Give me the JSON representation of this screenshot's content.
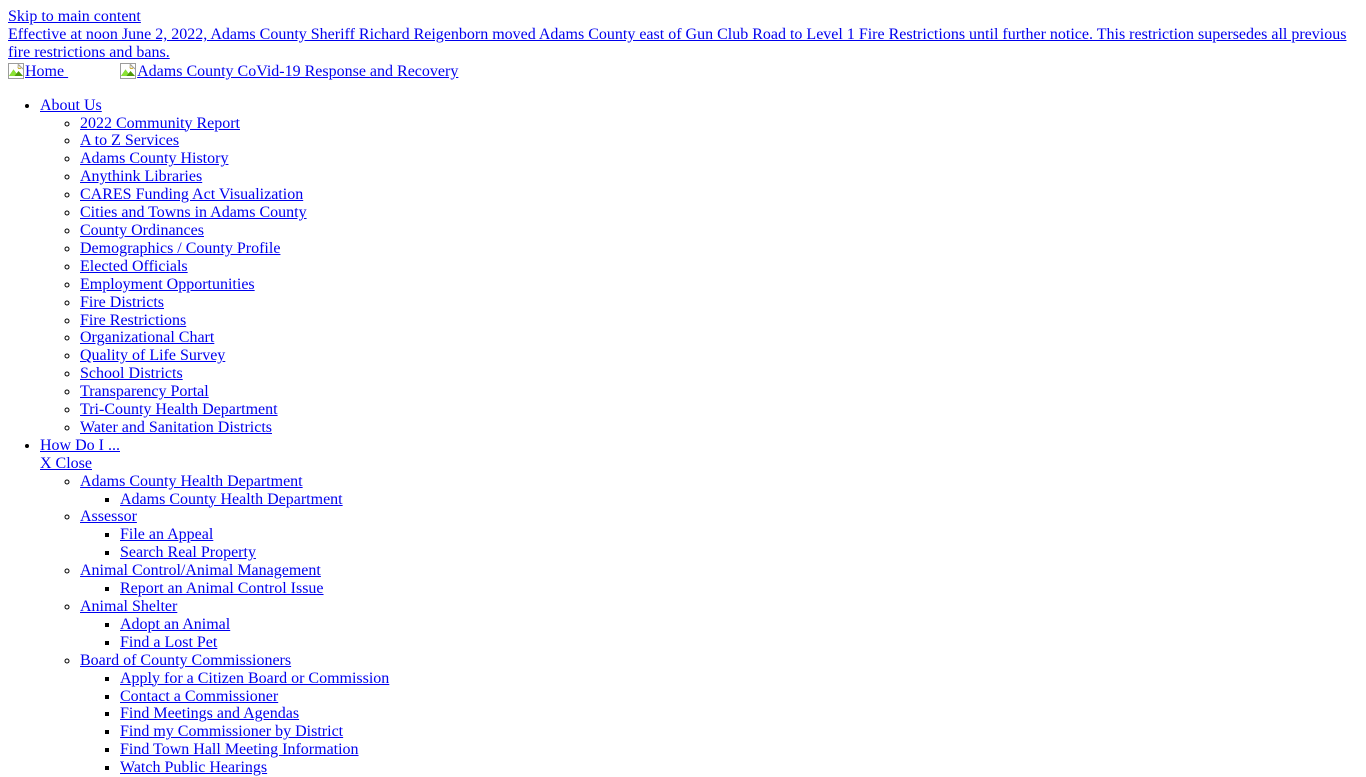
{
  "page": {
    "background": "#ffffff",
    "link_color": "#0000EE",
    "text_color": "#000000"
  },
  "skip_link": {
    "label": "Skip to main content"
  },
  "alert": {
    "text": "Effective at noon June 2, 2022, Adams County Sheriff Richard Reigenborn moved Adams County east of Gun Club Road to Level 1 Fire Restrictions until further notice. This restriction supersedes all previous fire restrictions and bans."
  },
  "header": {
    "home_link": {
      "label": "Home ",
      "icon": "broken-image-icon",
      "alt": "Home"
    },
    "covid_link": {
      "label": "Adams County CoVid-19 Response and Recovery",
      "icon": "broken-image-icon",
      "alt": "Adams County CoVid-19 Response and Recovery"
    }
  },
  "nav": {
    "items": [
      {
        "label": "About Us",
        "children": [
          {
            "label": "2022 Community Report"
          },
          {
            "label": "A to Z Services"
          },
          {
            "label": "Adams County History"
          },
          {
            "label": "Anythink Libraries"
          },
          {
            "label": "CARES Funding Act Visualization"
          },
          {
            "label": "Cities and Towns in Adams County"
          },
          {
            "label": "County Ordinances"
          },
          {
            "label": "Demographics / County Profile"
          },
          {
            "label": "Elected Officials"
          },
          {
            "label": "Employment Opportunities"
          },
          {
            "label": "Fire Districts"
          },
          {
            "label": "Fire Restrictions"
          },
          {
            "label": "Organizational Chart"
          },
          {
            "label": "Quality of Life Survey"
          },
          {
            "label": "School Districts"
          },
          {
            "label": "Transparency Portal"
          },
          {
            "label": "Tri-County Health Department"
          },
          {
            "label": "Water and Sanitation Districts"
          }
        ]
      },
      {
        "label": "How Do I ...",
        "close_label": "X Close",
        "children": [
          {
            "label": "Adams County Health Department",
            "children": [
              {
                "label": "Adams County Health Department"
              }
            ]
          },
          {
            "label": "Assessor",
            "children": [
              {
                "label": "File an Appeal"
              },
              {
                "label": "Search Real Property"
              }
            ]
          },
          {
            "label": "Animal Control/Animal Management",
            "children": [
              {
                "label": "Report an Animal Control Issue"
              }
            ]
          },
          {
            "label": "Animal Shelter",
            "children": [
              {
                "label": "Adopt an Animal"
              },
              {
                "label": "Find a Lost Pet"
              }
            ]
          },
          {
            "label": "Board of County Commissioners",
            "children": [
              {
                "label": "Apply for a Citizen Board or Commission"
              },
              {
                "label": "Contact a Commissioner"
              },
              {
                "label": "Find Meetings and Agendas"
              },
              {
                "label": "Find my Commissioner by District"
              },
              {
                "label": "Find Town Hall Meeting Information"
              },
              {
                "label": "Watch Public Hearings"
              }
            ]
          }
        ]
      }
    ]
  }
}
